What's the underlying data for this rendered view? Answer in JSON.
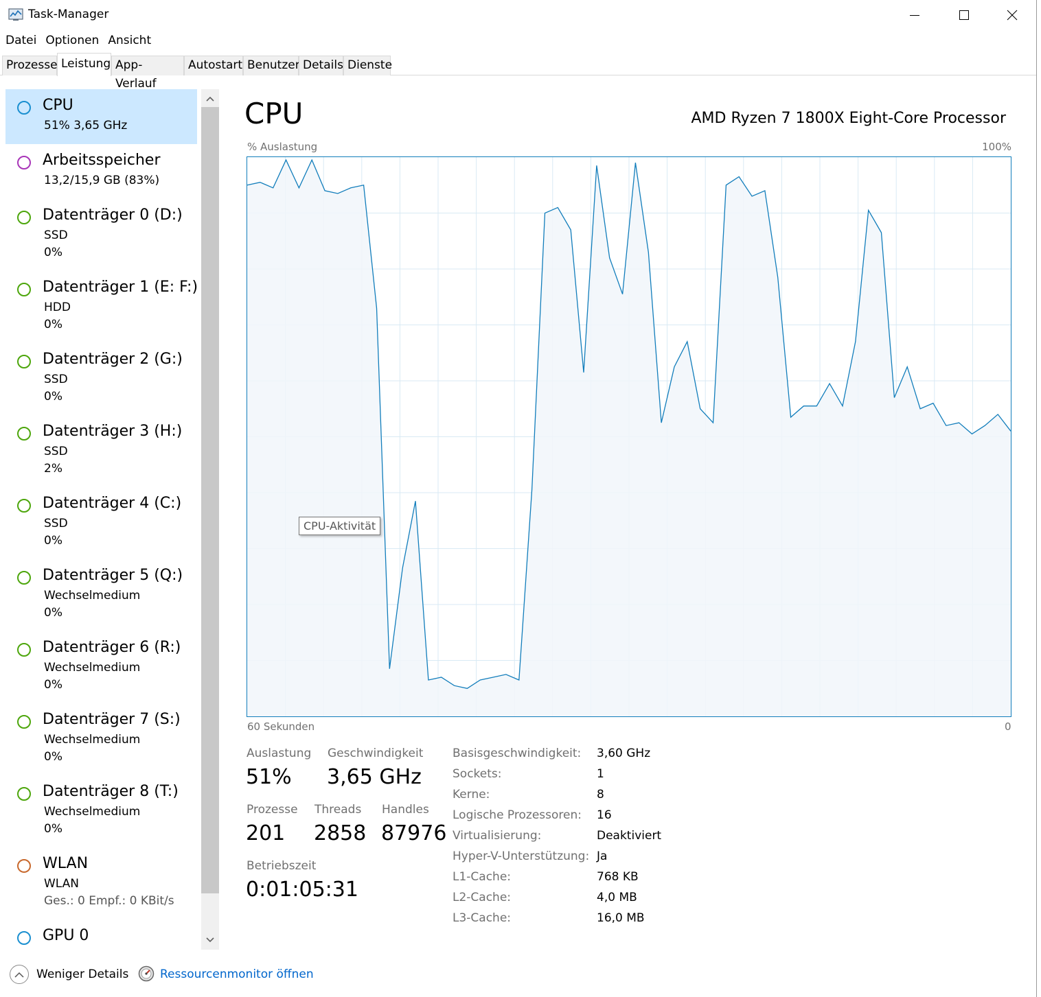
{
  "window": {
    "title": "Task-Manager"
  },
  "menu": [
    "Datei",
    "Optionen",
    "Ansicht"
  ],
  "tabs": [
    {
      "label": "Prozesse",
      "active": false
    },
    {
      "label": "Leistung",
      "active": true
    },
    {
      "label": "App-Verlauf",
      "active": false
    },
    {
      "label": "Autostart",
      "active": false
    },
    {
      "label": "Benutzer",
      "active": false
    },
    {
      "label": "Details",
      "active": false
    },
    {
      "label": "Dienste",
      "active": false
    }
  ],
  "sidebar": {
    "items": [
      {
        "name": "CPU",
        "lines": [
          "51%  3,65 GHz"
        ],
        "color": "#1a8fd0"
      },
      {
        "name": "Arbeitsspeicher",
        "lines": [
          "13,2/15,9 GB (83%)"
        ],
        "color": "#a835b8"
      },
      {
        "name": "Datenträger 0 (D:)",
        "lines": [
          "SSD",
          "0%"
        ],
        "color": "#4da60c"
      },
      {
        "name": "Datenträger 1 (E: F:)",
        "lines": [
          "HDD",
          "0%"
        ],
        "color": "#4da60c"
      },
      {
        "name": "Datenträger 2 (G:)",
        "lines": [
          "SSD",
          "0%"
        ],
        "color": "#4da60c"
      },
      {
        "name": "Datenträger 3 (H:)",
        "lines": [
          "SSD",
          "2%"
        ],
        "color": "#4da60c"
      },
      {
        "name": "Datenträger 4 (C:)",
        "lines": [
          "SSD",
          "0%"
        ],
        "color": "#4da60c"
      },
      {
        "name": "Datenträger 5 (Q:)",
        "lines": [
          "Wechselmedium",
          "0%"
        ],
        "color": "#4da60c"
      },
      {
        "name": "Datenträger 6 (R:)",
        "lines": [
          "Wechselmedium",
          "0%"
        ],
        "color": "#4da60c"
      },
      {
        "name": "Datenträger 7 (S:)",
        "lines": [
          "Wechselmedium",
          "0%"
        ],
        "color": "#4da60c"
      },
      {
        "name": "Datenträger 8 (T:)",
        "lines": [
          "Wechselmedium",
          "0%"
        ],
        "color": "#4da60c"
      },
      {
        "name": "WLAN",
        "lines": [
          "WLAN",
          "Ges.: 0  Empf.: 0 KBit/s"
        ],
        "color": "#c8682c"
      },
      {
        "name": "GPU 0",
        "lines": [],
        "color": "#1a8fd0"
      }
    ]
  },
  "main": {
    "title": "CPU",
    "model": "AMD Ryzen 7 1800X Eight-Core Processor",
    "tooltip": "CPU-Aktivität"
  },
  "chart_data": {
    "type": "area",
    "ylabel": "% Auslastung",
    "ymax_label": "100%",
    "xlabel_left": "60 Sekunden",
    "xlabel_right": "0",
    "ylim": [
      0,
      100
    ],
    "xlim": [
      60,
      0
    ],
    "grid": true,
    "line_color": "#117dbb",
    "fill_color": "#f1f6fa",
    "grid_color": "#d9eaf4",
    "values": [
      95,
      95.5,
      94.5,
      99.5,
      94.5,
      99.5,
      94,
      93.5,
      94.5,
      95,
      73,
      8.5,
      26.5,
      38.5,
      6.5,
      7,
      5.5,
      5,
      6.5,
      7,
      7.5,
      6.5,
      40.5,
      90,
      91,
      87,
      61.5,
      98.5,
      82,
      75.5,
      99,
      83,
      52.5,
      62.5,
      67,
      55,
      52.5,
      95,
      96.5,
      93,
      94,
      78.5,
      53.5,
      55.5,
      55.5,
      59.5,
      55.5,
      67,
      90.5,
      86.5,
      57,
      62.5,
      55,
      56,
      52,
      52.5,
      50.5,
      52,
      54,
      51
    ]
  },
  "stats": {
    "auslastung": {
      "label": "Auslastung",
      "value": "51%"
    },
    "geschwindigkeit": {
      "label": "Geschwindigkeit",
      "value": "3,65 GHz"
    },
    "prozesse": {
      "label": "Prozesse",
      "value": "201"
    },
    "threads": {
      "label": "Threads",
      "value": "2858"
    },
    "handles": {
      "label": "Handles",
      "value": "87976"
    },
    "betriebszeit": {
      "label": "Betriebszeit",
      "value": "0:01:05:31"
    }
  },
  "properties": [
    {
      "label": "Basisgeschwindigkeit:",
      "value": "3,60 GHz"
    },
    {
      "label": "Sockets:",
      "value": "1"
    },
    {
      "label": "Kerne:",
      "value": "8"
    },
    {
      "label": "Logische Prozessoren:",
      "value": "16"
    },
    {
      "label": "Virtualisierung:",
      "value": "Deaktiviert"
    },
    {
      "label": "Hyper-V-Unterstützung:",
      "value": "Ja"
    },
    {
      "label": "L1-Cache:",
      "value": "768 KB"
    },
    {
      "label": "L2-Cache:",
      "value": "4,0 MB"
    },
    {
      "label": "L3-Cache:",
      "value": "16,0 MB"
    }
  ],
  "footer": {
    "fewer_details": "Weniger Details",
    "resource_monitor": "Ressourcenmonitor öffnen"
  }
}
